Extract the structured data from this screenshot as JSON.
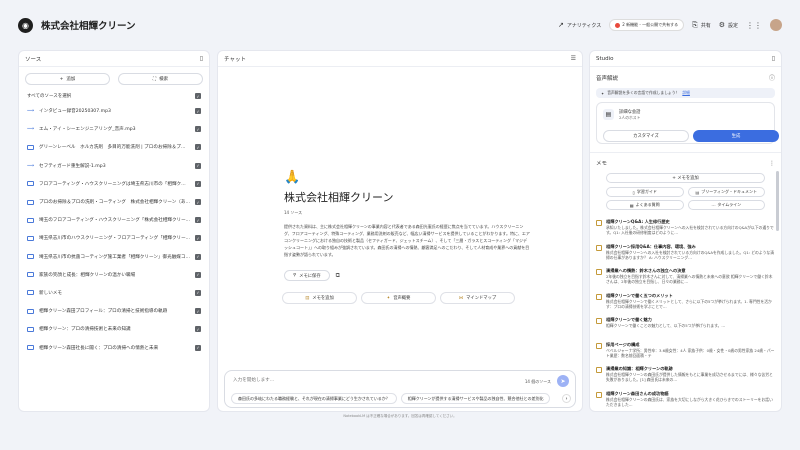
{
  "app": {
    "title": "株式会社相輝クリーン",
    "logo_icon": "logo-icon"
  },
  "topbar": {
    "analytics": "アナリティクス",
    "pill": "2 新機能 - 一般公開で共有する",
    "share": "共有",
    "settings": "設定"
  },
  "sources": {
    "header": "ソース",
    "add_label": "追加",
    "search_label": "検索",
    "select_all": "すべてのソースを選択",
    "items": [
      {
        "label": "インタビュー録音20250307.mp3",
        "type": "audio"
      },
      {
        "label": "エム・アイ・シーエンジニアリング_音声.mp3",
        "type": "audio"
      },
      {
        "label": "グリーンレーベル　ホルカ洗剤　多目的万能洗剤 | プロのお掃除＆プロ…",
        "type": "doc"
      },
      {
        "label": "セフティガード重生解説-1.mp3",
        "type": "audio"
      },
      {
        "label": "フロアコーティング・ハウスクリーニングは埼玉県志川市の「相輝ク…",
        "type": "doc"
      },
      {
        "label": "プロのお掃除＆プロの洗剤・コーティング　株式会社相輝クリーン（あい…",
        "type": "doc"
      },
      {
        "label": "埼玉のフロアコーティング・ハウスクリーニング「株式会社相輝クリーン」",
        "type": "doc"
      },
      {
        "label": "埼玉県志川市のハウスクリーニング・フロアコーティング「相輝クリーン…",
        "type": "doc"
      },
      {
        "label": "埼玉県志川市の抗菌コーティング施工業者「相輝クリーン」御光触媒コー…",
        "type": "doc"
      },
      {
        "label": "家族の笑顔と成長：相輝クリーンの温かい職場",
        "type": "doc"
      },
      {
        "label": "新しいメモ",
        "type": "doc"
      },
      {
        "label": "相輝クリーン森田プロフィール：プロの清掃と技術指導の軌跡",
        "type": "doc"
      },
      {
        "label": "相輝クリーン：プロの清掃技術と未来の知識",
        "type": "doc"
      },
      {
        "label": "相輝クリーン森田社長に聞く：プロの清掃への情熱と未来",
        "type": "doc"
      }
    ]
  },
  "chat": {
    "header": "チャット",
    "emoji": "🙏",
    "title": "株式会社相輝クリーン",
    "count": "14 ソース",
    "summary": "提供された資料は、主に株式会社相輝クリーンの事業内容と代表者である森田光憲氏の経歴に焦点を当てています。ハウスクリーニング、フロアコーティング、特殊コーティング、業務用洗剤の販売など、幅広い清掃サービスを提供していることがわかります。特に、エアコンクリーニングにおける独自の技術と製品（セフティガード、ジェットスチーム）、そして「三層・ガラスとスコーティング「マジデッシュコート」」への取り組みが強調されています。森田氏の清掃への情熱、顧客満足へのこだわり、そして人材育成や業界への貢献を目指す姿勢が語られています。",
    "save_note": "メモに保存",
    "actions": [
      "メモを追加",
      "音声概要",
      "マインドマップ"
    ],
    "input_placeholder": "入力を開始します...",
    "source_count": "14 個のソース",
    "suggestions": [
      "森田氏の多岐にわたる職務経験と、それが現在の清掃事業にどう生かされているか？",
      "相輝クリーンが提供する清掃サービスや製品の独自性、競合他社との差別化"
    ]
  },
  "studio": {
    "header": "Studio",
    "audio_label": "音声解説",
    "notice": "音声解説を多くの言語で作成しましょう！",
    "notice_link": "詳細",
    "card_title": "詳細な会話",
    "card_sub": "2人のホスト",
    "customize": "カスタマイズ",
    "generate": "生成",
    "memo_label": "メモ",
    "memo_add": "メモを追加",
    "chips": [
      "学習ガイド",
      "ブリーフィング・ドキュメント",
      "よくある質問",
      "タイムライン"
    ],
    "notes": [
      {
        "title": "相輝クリーンQ&A: 人生修行歴史",
        "body": "承知いたしました。株式会社相輝クリーンへの入社を検討されている方向けのQ&Aが以下の通りです。Q1: 入社後の研修制度はどのように…"
      },
      {
        "title": "相輝クリーン採用Q&A：仕事内容、環境、強み",
        "body": "株式会社相輝クリーンへの入社を検討されている方向けのQ&Aを作成しました。Q1: どのような清掃の仕事がありますか？ A: ハウスクリーニング…"
      },
      {
        "title": "清掃業への情熱：鈴木さんの独立への決意",
        "body": "2年後の独立を目指す鈴木さんに対して、清掃業への情熱と未来への意欲 相輝クリーンで働く鈴木さんは、2年後の独立を目指し、日々の業務に…"
      },
      {
        "title": "相輝クリーンで働く五つのメリット",
        "body": "株式会社相輝クリーンで働くメリットとして、さらに以下の5つが挙げられます。1. 専門性を活かす：プロの清掃技術を学ぶことで…"
      },
      {
        "title": "相輝クリーンで働く魅力",
        "body": "相輝クリーンで働くことの魅力として、以下の5つが挙げられます。…"
      },
      {
        "title": "採用ページの構成",
        "body": "ベベルジャーナ学所：男性卒：3.6歳女性：4人 家族子供：0歳・女性・0歳の男性家族 24歳・パート業歴：数名前回面積・テ"
      },
      {
        "title": "清掃業の知識：相輝クリーンの軌跡",
        "body": "株式会社相輝クリーンの森田氏が提供した情報をもとに事業を成功させるまでには、様々な苦労と失敗がありました。[1] 森田氏は未来の…"
      },
      {
        "title": "相輝クリーン森田さんの成功物語",
        "body": "株式会社相輝クリーンの森田氏は、家族を大切にしながら大きく花ひらきでのストーリーをお話いただきました…"
      }
    ]
  },
  "footer": "NotebookLM は不正確な場合があります。回答は再確認してください。"
}
